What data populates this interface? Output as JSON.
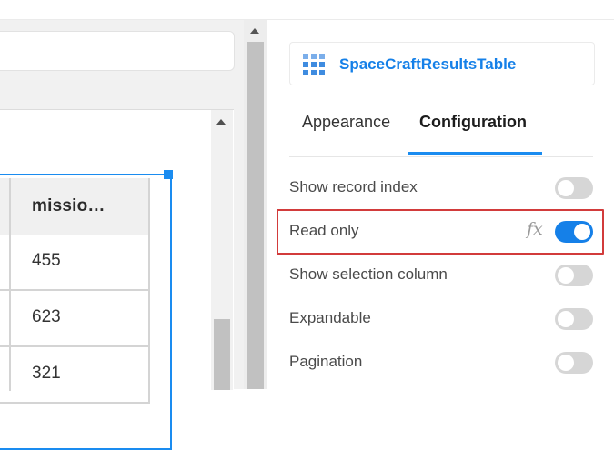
{
  "canvas": {
    "table": {
      "column_header": "missio…",
      "rows": [
        "455",
        "623",
        "321"
      ]
    }
  },
  "property_pane": {
    "widget_name": "SpaceCraftResultsTable",
    "widget_icon": "table-grid-icon",
    "tabs": [
      {
        "label": "Appearance",
        "active": false
      },
      {
        "label": "Configuration",
        "active": true
      }
    ],
    "properties": [
      {
        "label": "Show record index",
        "enabled": false
      },
      {
        "label": "Read only",
        "enabled": true,
        "fx_label": "fx",
        "highlighted": true
      },
      {
        "label": "Show selection column",
        "enabled": false
      },
      {
        "label": "Expandable",
        "enabled": false
      },
      {
        "label": "Pagination",
        "enabled": false
      }
    ]
  },
  "colors": {
    "accent": "#1580e8",
    "selection": "#1a8cf0",
    "highlight_border": "#d23b3b"
  }
}
